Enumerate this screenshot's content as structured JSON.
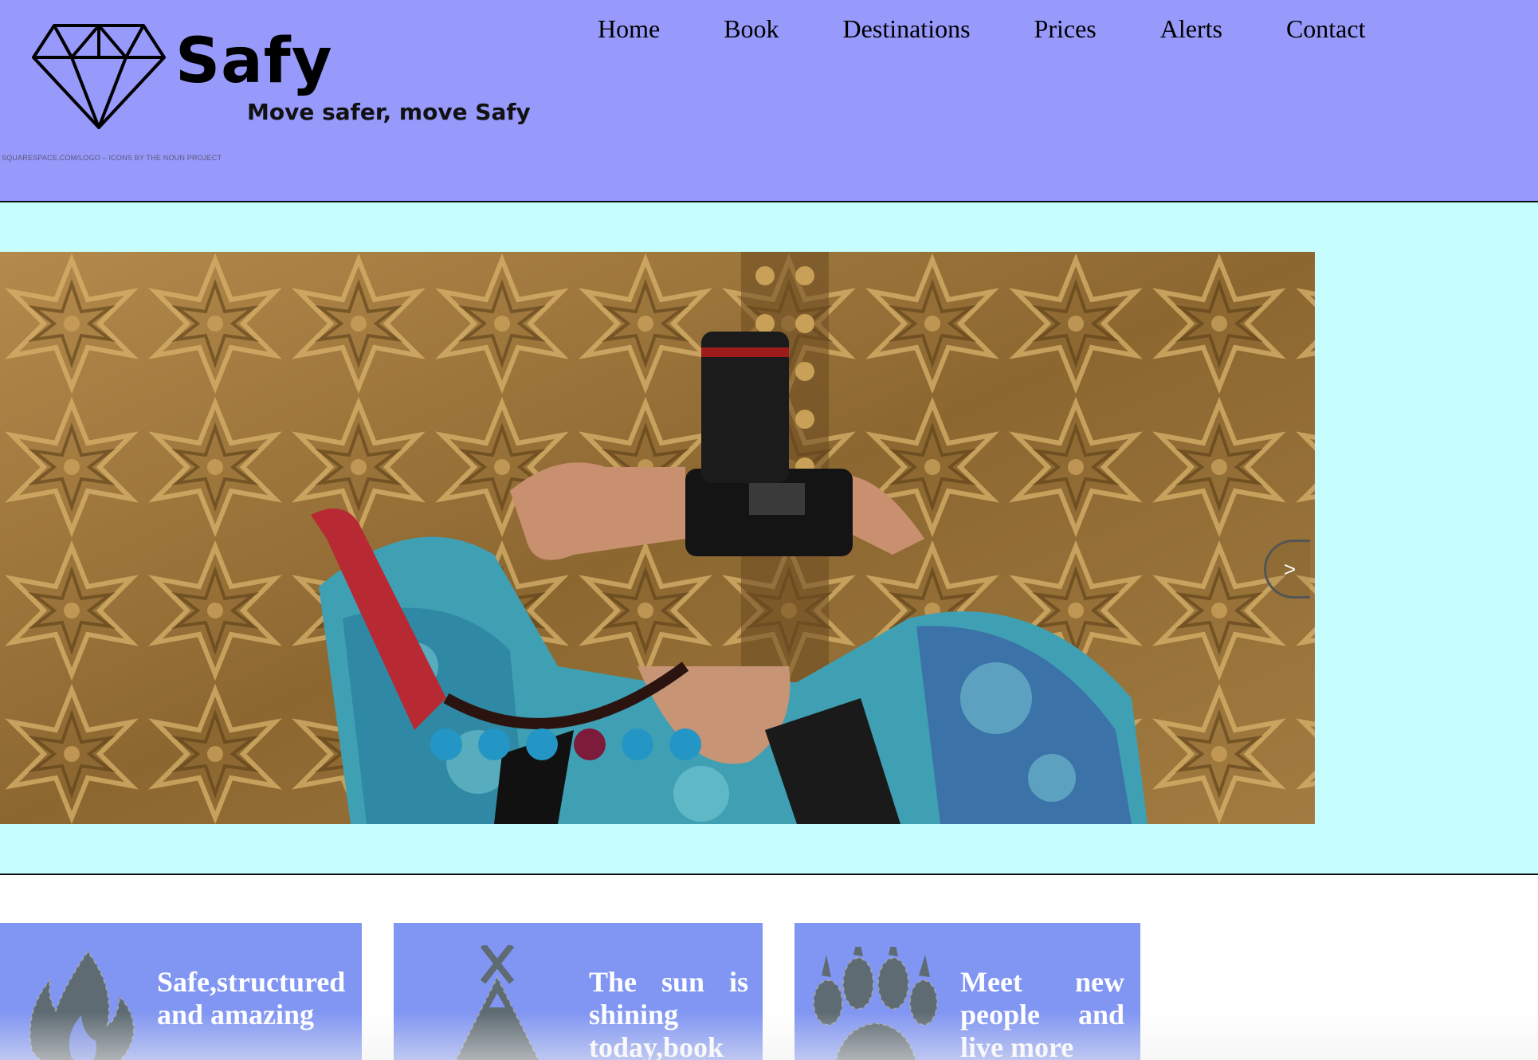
{
  "header": {
    "brand_name": "Safy",
    "tagline": "Move safer, move Safy",
    "credit": "SQUARESPACE.COM/LOGO – ICONS BY THE NOUN PROJECT",
    "logo_icon": "diamond-icon",
    "background_color": "#9799fb"
  },
  "nav": {
    "items": [
      {
        "label": "Home"
      },
      {
        "label": "Book"
      },
      {
        "label": "Destinations"
      },
      {
        "label": "Prices"
      },
      {
        "label": "Alerts"
      },
      {
        "label": "Contact"
      }
    ]
  },
  "hero": {
    "background_color": "#c6feff",
    "slide_image": "photographer-taking-photo-in-front-of-ornate-golden-door",
    "next_button_label": ">",
    "dots": {
      "count": 6,
      "active_index": 3,
      "color": "#2496c6",
      "active_color": "#7d1b3b"
    }
  },
  "cards": [
    {
      "icon": "campfire-icon",
      "text": "Safe,structured and amazing"
    },
    {
      "icon": "tent-icon",
      "text": "The sun is shining today,book"
    },
    {
      "icon": "paw-print-icon",
      "text": "Meet new people and live more"
    }
  ],
  "card_color": "#8196f2"
}
